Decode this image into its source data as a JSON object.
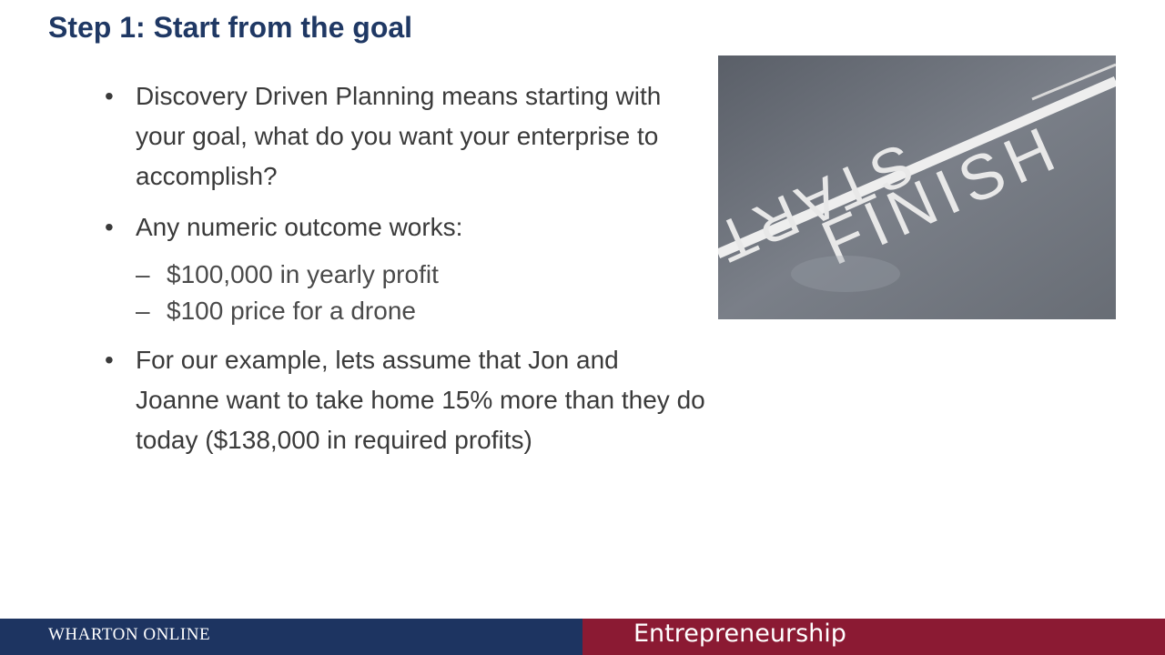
{
  "slide": {
    "title": "Step 1: Start from the goal",
    "bullets": [
      {
        "marker": "•",
        "text": "Discovery Driven Planning means starting with your goal, what do you want your enterprise to accomplish?"
      },
      {
        "marker": "•",
        "text": "Any numeric outcome works:",
        "subitems": [
          {
            "marker": "–",
            "text": "$100,000 in yearly profit"
          },
          {
            "marker": "–",
            "text": "$100 price for a drone"
          }
        ]
      },
      {
        "marker": "•",
        "text": "For our example, lets assume that Jon and Joanne want to take home 15% more than they do today ($138,000 in required profits)"
      }
    ],
    "photo": {
      "start_text": "START",
      "finish_text": "FINISH"
    }
  },
  "footer": {
    "brand": "WHARTON ONLINE",
    "course": "Entrepreneurship",
    "left_color": "#1d3461",
    "right_color": "#8b1a33"
  },
  "colors": {
    "title": "#1f3864",
    "body_text": "#3a3a3a"
  }
}
